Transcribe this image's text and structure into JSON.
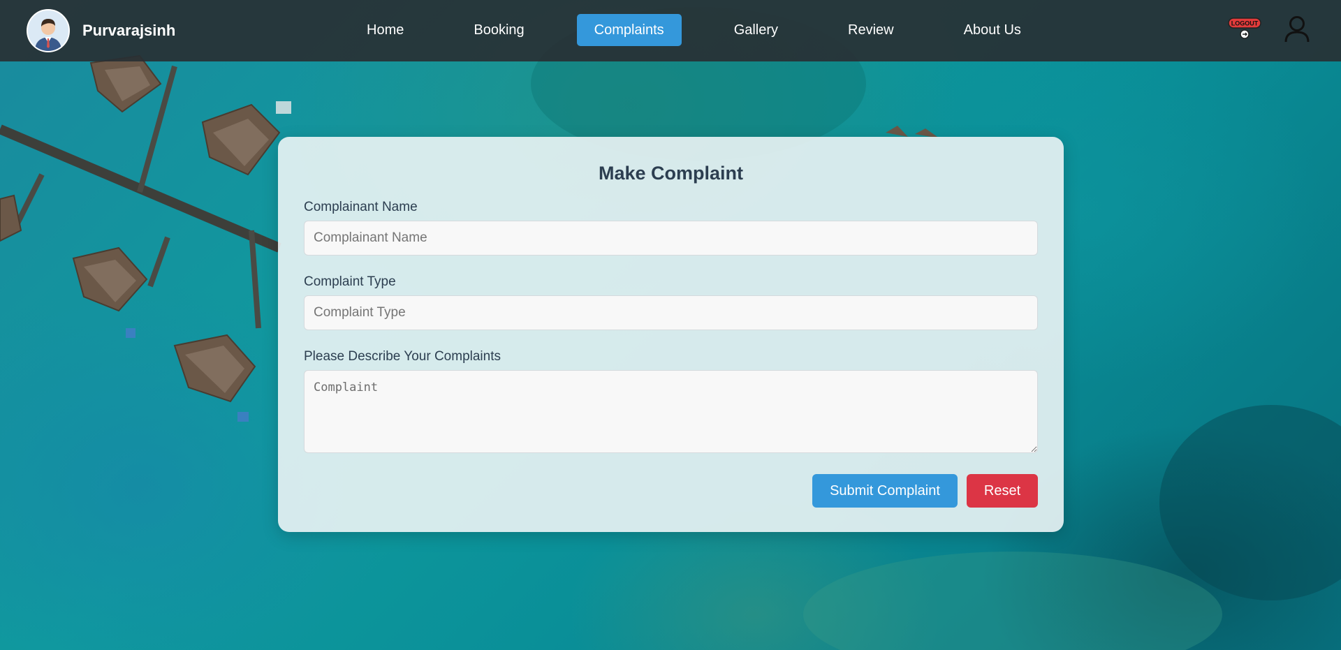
{
  "navbar": {
    "username": "Purvarajsinh",
    "links": [
      {
        "label": "Home"
      },
      {
        "label": "Booking"
      },
      {
        "label": "Complaints",
        "active": true
      },
      {
        "label": "Gallery"
      },
      {
        "label": "Review"
      },
      {
        "label": "About Us"
      }
    ],
    "logout_badge_text": "LOGOUT",
    "icons": {
      "avatar": "user-avatar-icon",
      "logout": "logout-icon",
      "profile": "user-profile-icon"
    }
  },
  "form": {
    "title": "Make Complaint",
    "complainant_name": {
      "label": "Complainant Name",
      "placeholder": "Complainant Name",
      "value": ""
    },
    "complaint_type": {
      "label": "Complaint Type",
      "placeholder": "Complaint Type",
      "value": ""
    },
    "description": {
      "label": "Please Describe Your Complaints",
      "placeholder": "Complaint",
      "value": ""
    },
    "submit_label": "Submit Complaint",
    "reset_label": "Reset"
  },
  "colors": {
    "navbar_bg": "#283034",
    "accent": "#3498db",
    "danger": "#dc3545",
    "title_text": "#2c3e50"
  }
}
